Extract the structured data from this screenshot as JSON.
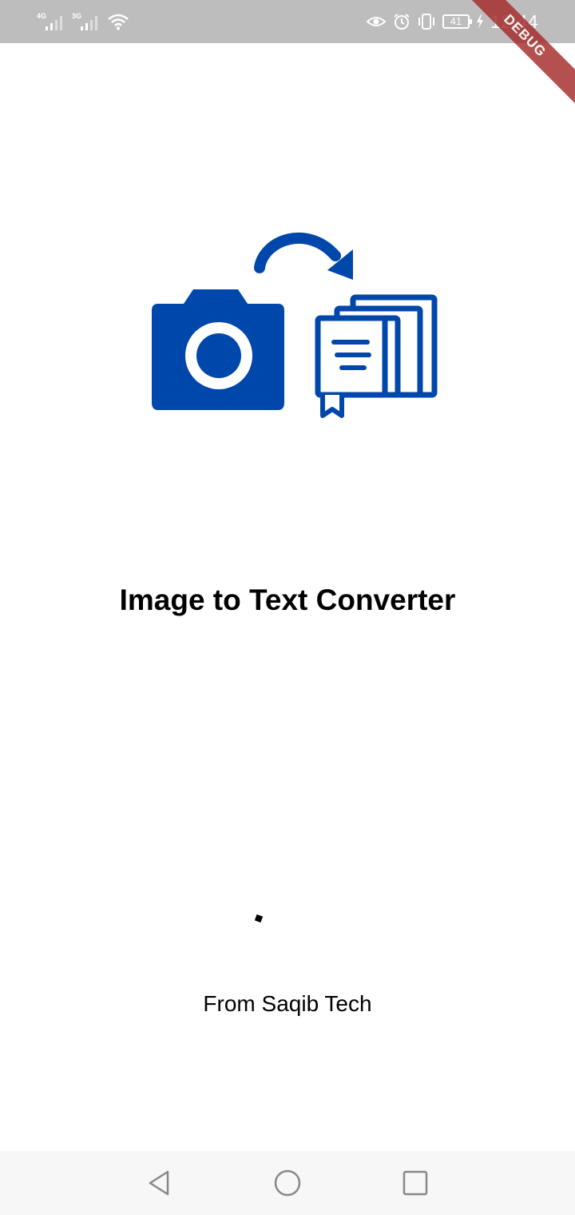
{
  "status_bar": {
    "signal_1_label": "4G",
    "signal_2_label": "3G",
    "battery_level": "41",
    "time": "12:44",
    "icons": [
      "signal-4g-icon",
      "signal-3g-icon",
      "wifi-icon",
      "eye-comfort-icon",
      "alarm-icon",
      "vibrate-icon",
      "battery-icon",
      "charging-icon"
    ]
  },
  "debug_banner": {
    "label": "DEBUG",
    "color": "#a52a2a"
  },
  "splash": {
    "logo_icon": "image-to-text-logo",
    "logo_color": "#0047ab",
    "title": "Image to Text Converter",
    "credit": "From Saqib Tech"
  },
  "nav_bar": {
    "icons": [
      "back-icon",
      "home-icon",
      "recents-icon"
    ]
  }
}
